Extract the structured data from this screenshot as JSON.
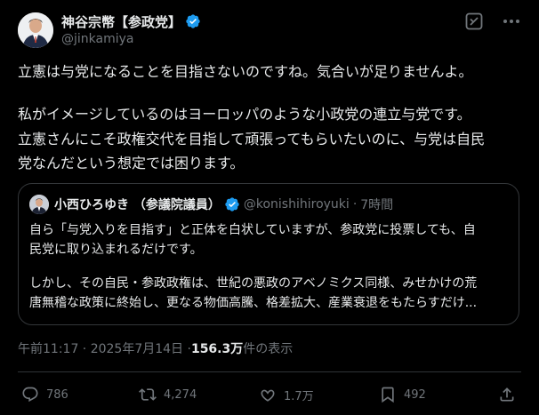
{
  "author": {
    "display_name": "神谷宗幣【参政党】",
    "handle": "@jinkamiya",
    "verified": true
  },
  "post": {
    "lines": [
      "立憲は与党になることを目指さないのですね。気合いが足りませんよ。",
      "",
      "私がイメージしているのはヨーロッパのような小政党の連立与党です。",
      "立憲さんにこそ政権交代を目指して頑張ってもらいたいのに、与党は自民",
      "党なんだという想定では困ります。"
    ]
  },
  "quote": {
    "display_name": "小西ひろゆき （参議院議員）",
    "handle": "@konishihiroyuki",
    "separator": "·",
    "time": "7時間",
    "lines": [
      "自ら「与党入りを目指す」と正体を白状していますが、参政党に投票しても、自",
      "民党に取り込まれるだけです。",
      "",
      "しかし、その自民・参政政権は、世紀の悪政のアベノミクス同様、みせかけの荒",
      "唐無稽な政策に終始し、更なる物価高騰、格差拡大、産業衰退をもたらすだけ..."
    ]
  },
  "meta": {
    "timestamp": "午前11:17 · 2025年7月14日 · ",
    "views": "156.3万",
    "views_label": " 件の表示"
  },
  "actions": {
    "replies": "786",
    "reposts": "4,274",
    "likes": "1.7万",
    "bookmarks": "492"
  },
  "colors": {
    "background": "#000000",
    "text": "#e7e9ea",
    "secondary": "#71767b",
    "verified": "#1d9bf0",
    "border": "#333639"
  },
  "icons": {
    "verified": "verified-badge-icon",
    "grok": "grok-icon",
    "more": "more-icon",
    "reply": "reply-icon",
    "repost": "repost-icon",
    "like": "heart-icon",
    "bookmark": "bookmark-icon",
    "share": "share-icon"
  }
}
